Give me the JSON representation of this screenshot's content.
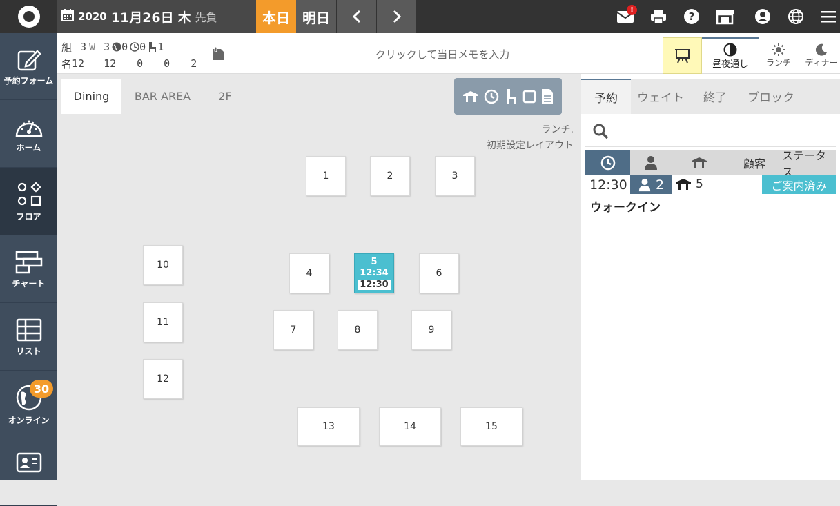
{
  "header": {
    "year": "2020",
    "month_day": "11月26日",
    "weekday": "木",
    "rokuyo": "先負",
    "today_label": "本日",
    "tomorrow_label": "明日",
    "mail_badge": "!"
  },
  "sidebar": {
    "items": [
      {
        "label": "予約フォーム",
        "icon": "edit-icon"
      },
      {
        "label": "ホーム",
        "icon": "gauge-icon"
      },
      {
        "label": "フロア",
        "icon": "shapes-icon"
      },
      {
        "label": "チャート",
        "icon": "chart-icon"
      },
      {
        "label": "リスト",
        "icon": "table-icon"
      },
      {
        "label": "オンライン",
        "icon": "globe-icon",
        "badge": "30"
      },
      {
        "label": "",
        "icon": "contact-card-icon"
      }
    ]
  },
  "stats": {
    "row1": {
      "label": "組",
      "total": "3",
      "w_label": "W",
      "w": "3",
      "web": "0",
      "time": "0",
      "seat": "1"
    },
    "row2": {
      "label": "名",
      "total": "12",
      "w": "12",
      "web": "0",
      "time": "0",
      "seat": "2"
    }
  },
  "memo": {
    "placeholder": "クリックして当日メモを入力"
  },
  "modes": [
    {
      "label": "昼夜通し",
      "icon": "half-circle-icon"
    },
    {
      "label": "ランチ",
      "icon": "sun-icon"
    },
    {
      "label": "ディナー",
      "icon": "moon-icon"
    }
  ],
  "floor": {
    "tabs": [
      "Dining",
      "BAR AREA",
      "2F"
    ],
    "layout_line1": "ランチ.",
    "layout_line2": "初期設定レイアウト",
    "tables": [
      {
        "id": "1"
      },
      {
        "id": "2"
      },
      {
        "id": "3"
      },
      {
        "id": "4"
      },
      {
        "id": "5",
        "occupied": true,
        "time1": "12:34",
        "time2": "12:30"
      },
      {
        "id": "6"
      },
      {
        "id": "7"
      },
      {
        "id": "8"
      },
      {
        "id": "9"
      },
      {
        "id": "10"
      },
      {
        "id": "11"
      },
      {
        "id": "12"
      },
      {
        "id": "13"
      },
      {
        "id": "14"
      },
      {
        "id": "15"
      }
    ]
  },
  "reservations": {
    "tabs": [
      "予約",
      "ウェイト",
      "終了",
      "ブロック"
    ],
    "columns": {
      "customer": "顧客",
      "status": "ステータス"
    },
    "rows": [
      {
        "time": "12:30",
        "people": "2",
        "table": "5",
        "status": "ご案内済み",
        "name": "ウォークイン"
      }
    ]
  }
}
